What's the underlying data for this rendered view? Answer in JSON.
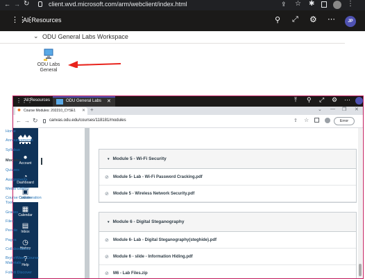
{
  "top_browser": {
    "url": "client.wvd.microsoft.com/arm/webclient/index.html",
    "all_resources": "All Resources",
    "workspace_title": "ODU General Labs Workspace",
    "app_tile_label_1": "ODU Labs",
    "app_tile_label_2": "General",
    "profile_initials": "JP"
  },
  "session_bar": {
    "all_resources": "All Resources",
    "tab_label": "ODU General Labs"
  },
  "browser2": {
    "tab_title": "Course Modules: 202210_CYSE1",
    "url": "canvas.odu.edu/courses/118181/modules",
    "error_label": "Error"
  },
  "global_nav": [
    {
      "label": "Account",
      "icon": "account-icon"
    },
    {
      "label": "Dashboard",
      "icon": "dashboard-icon"
    },
    {
      "label": "Courses",
      "icon": "courses-icon"
    },
    {
      "label": "Calendar",
      "icon": "calendar-icon"
    },
    {
      "label": "Inbox",
      "icon": "inbox-icon"
    },
    {
      "label": "History",
      "icon": "history-icon"
    },
    {
      "label": "Help",
      "icon": "help-icon"
    }
  ],
  "course_nav": [
    "Home",
    "Announcements",
    "Syllabus",
    "Modules",
    "Quizzes",
    "Assignments",
    "Media Gallery",
    "Course Collaboration",
    "Tool",
    "Grades",
    "Files",
    "People",
    "Pages",
    "Collaborations",
    "BryterWave Course",
    "Materials",
    "Follett Discover"
  ],
  "modules": [
    {
      "title": "Module 5 - Wi-Fi Security",
      "items": [
        "Module 5- Lab - Wi-Fi Password Cracking.pdf",
        "Module 5 - Wireless Network Security.pdf"
      ]
    },
    {
      "title": "Module 6 - Digital Steganography",
      "items": [
        "Module 6- Lab - Digital Steganography(steghide).pdf",
        "Module 6 - slide - Information Hiding.pdf",
        "M6 - Lab Files.zip"
      ]
    }
  ],
  "colors": {
    "canvas_nav": "#0f3359",
    "arrow": "#e8231c",
    "teams_purple": "#4f52b2"
  }
}
